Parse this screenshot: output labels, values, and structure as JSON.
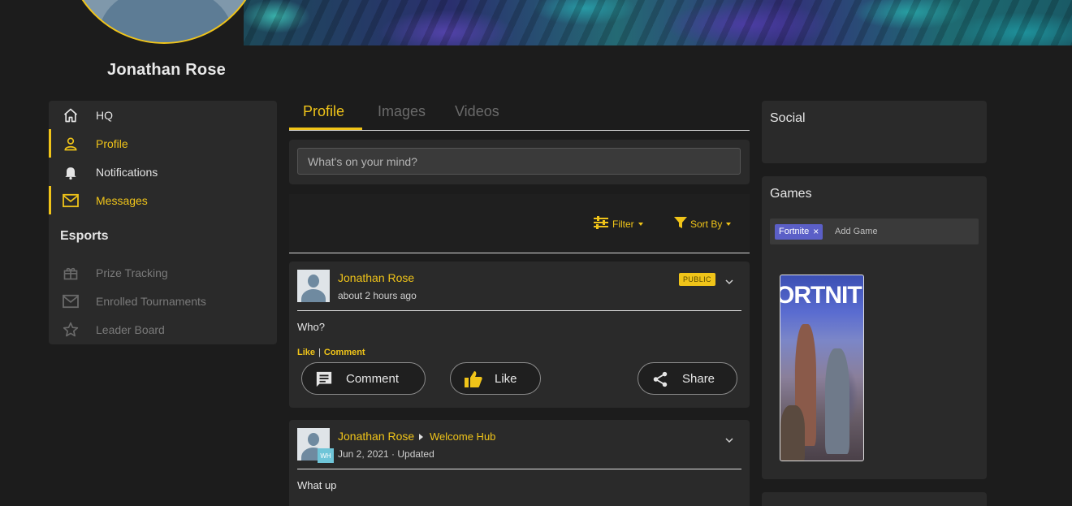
{
  "profile": {
    "name": "Jonathan Rose"
  },
  "nav": {
    "items": [
      {
        "label": "HQ",
        "icon": "home-icon",
        "active": false
      },
      {
        "label": "Profile",
        "icon": "person-icon",
        "active": true
      },
      {
        "label": "Notifications",
        "icon": "bell-icon",
        "active": false
      },
      {
        "label": "Messages",
        "icon": "envelope-icon",
        "active": true
      }
    ],
    "section_title": "Esports",
    "esports_items": [
      {
        "label": "Prize Tracking",
        "icon": "gift-icon"
      },
      {
        "label": "Enrolled Tournaments",
        "icon": "envelope-icon"
      },
      {
        "label": "Leader Board",
        "icon": "star-icon"
      }
    ]
  },
  "tabs": [
    {
      "label": "Profile",
      "active": true
    },
    {
      "label": "Images",
      "active": false
    },
    {
      "label": "Videos",
      "active": false
    }
  ],
  "composer": {
    "placeholder": "What's on your mind?"
  },
  "filters": {
    "filter_label": "Filter",
    "sort_label": "Sort By"
  },
  "posts": [
    {
      "author": "Jonathan Rose",
      "time": "about 2 hours ago",
      "visibility": "PUBLIC",
      "text": "Who?",
      "link_like": "Like",
      "link_sep": "|",
      "link_comment": "Comment",
      "btn_comment": "Comment",
      "btn_like": "Like",
      "btn_share": "Share"
    },
    {
      "author": "Jonathan Rose",
      "hub": "Welcome Hub",
      "hub_badge": "WH",
      "time": "Jun 2, 2021 · Updated",
      "text": "What up"
    }
  ],
  "right": {
    "social_title": "Social",
    "games_title": "Games",
    "game_chip": "Fortnite",
    "chip_remove": "×",
    "add_game_placeholder": "Add Game",
    "cover_title": "ORTNIT"
  },
  "colors": {
    "accent": "#f0c419",
    "chip": "#5b5fc7",
    "panel": "#2a2a2a",
    "background": "#1c1c1c"
  }
}
